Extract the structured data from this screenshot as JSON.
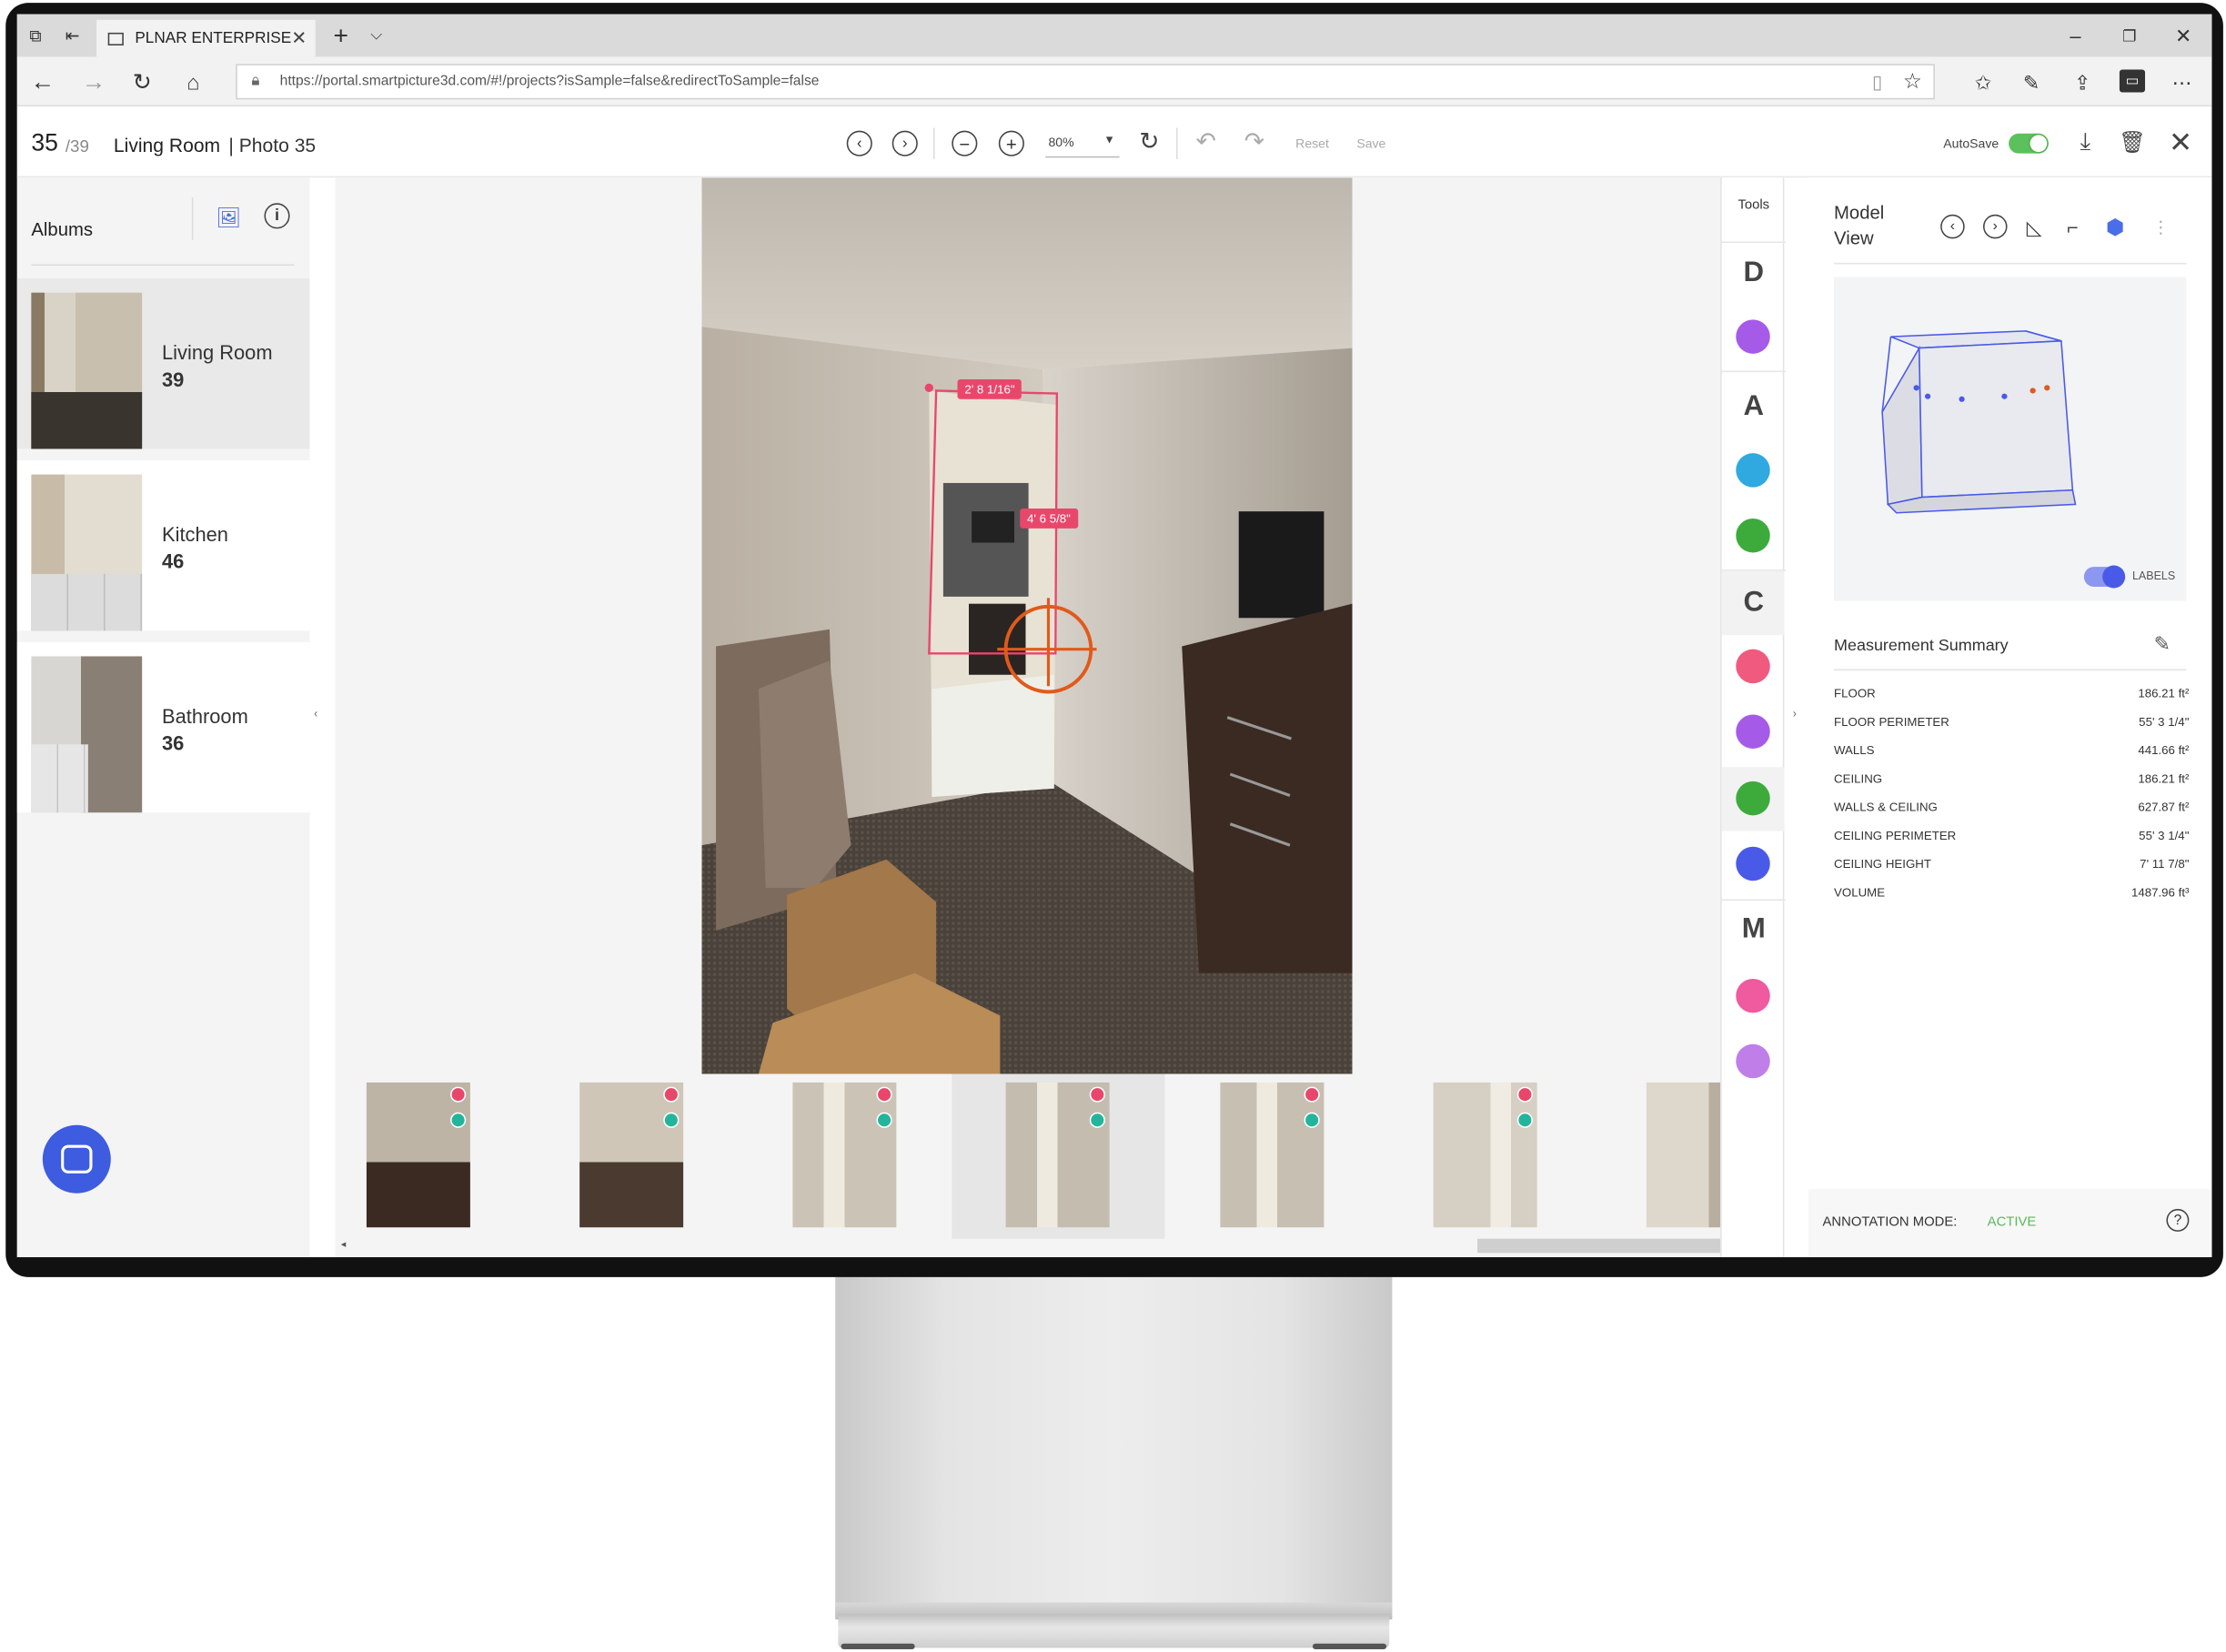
{
  "browser": {
    "tab_title": "PLNAR ENTERPRISE",
    "url": "https://portal.smartpicture3d.com/#!/projects?isSample=false&redirectToSample=false"
  },
  "header": {
    "photo_index": "35",
    "photo_total": "/39",
    "album_name": "Living Room",
    "photo_label": "| Photo 35",
    "zoom": "80%",
    "reset_label": "Reset",
    "save_label": "Save",
    "autosave_label": "AutoSave"
  },
  "sidebar": {
    "title": "Albums",
    "albums": [
      {
        "name": "Living Room",
        "count": "39"
      },
      {
        "name": "Kitchen",
        "count": "46"
      },
      {
        "name": "Bathroom",
        "count": "36"
      }
    ]
  },
  "photo": {
    "measure_top": "2' 8 1/16\"",
    "measure_side": "4' 6 5/8\""
  },
  "tools": {
    "title": "Tools",
    "letters": [
      "D",
      "A",
      "C",
      "M"
    ]
  },
  "right_panel": {
    "title_line1": "Model",
    "title_line2": "View",
    "labels_toggle": "LABELS",
    "summary_title": "Measurement Summary",
    "measurements": [
      {
        "label": "FLOOR",
        "value": "186.21 ft²"
      },
      {
        "label": "FLOOR PERIMETER",
        "value": "55' 3 1/4\""
      },
      {
        "label": "WALLS",
        "value": "441.66 ft²"
      },
      {
        "label": "CEILING",
        "value": "186.21 ft²"
      },
      {
        "label": "WALLS & CEILING",
        "value": "627.87 ft²"
      },
      {
        "label": "CEILING PERIMETER",
        "value": "55' 3 1/4\""
      },
      {
        "label": "CEILING HEIGHT",
        "value": "7' 11 7/8\""
      },
      {
        "label": "VOLUME",
        "value": "1487.96 ft³"
      }
    ],
    "annotation_label": "ANNOTATION MODE:",
    "annotation_value": "ACTIVE"
  },
  "colors": {
    "accent_pink": "#e8476b",
    "active_green": "#5cb85c",
    "toggle_blue": "#4a5ae8"
  }
}
